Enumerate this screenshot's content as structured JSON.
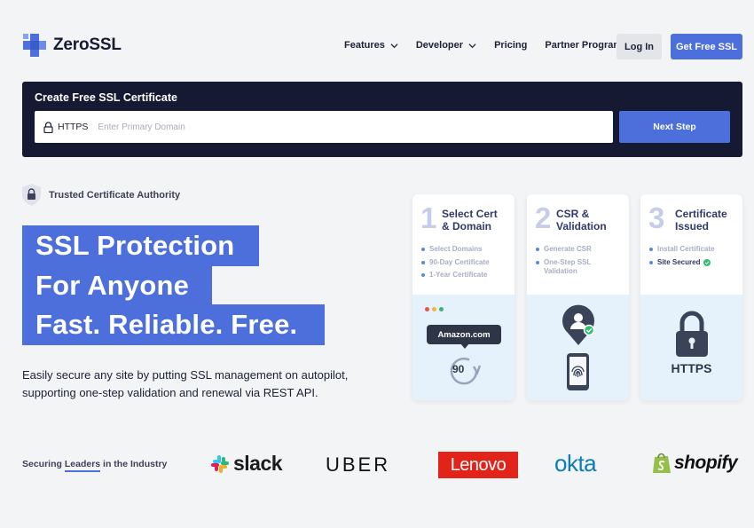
{
  "header": {
    "logo_text": "ZeroSSL",
    "nav": [
      {
        "label": "Features",
        "has_dropdown": true
      },
      {
        "label": "Developer",
        "has_dropdown": true
      },
      {
        "label": "Pricing",
        "has_dropdown": false
      },
      {
        "label": "Partner Program",
        "has_dropdown": false
      }
    ],
    "login_label": "Log In",
    "cta_label": "Get Free SSL"
  },
  "create": {
    "title": "Create Free SSL Certificate",
    "prefix": "HTTPS",
    "placeholder": "Enter Primary Domain",
    "value": "",
    "next_label": "Next Step"
  },
  "hero": {
    "trusted": "Trusted Certificate Authority",
    "line1": "SSL Protection",
    "line2": "For Anyone",
    "line3": "Fast. Reliable. Free.",
    "subtitle": "Easily secure any site by putting SSL management on autopilot, supporting one-step validation and renewal via REST API."
  },
  "steps": [
    {
      "num": "1",
      "title_line1": "Select Cert",
      "title_line2": "& Domain",
      "items": [
        "Select Domains",
        "90-Day Certificate",
        "1-Year Certificate"
      ],
      "pill": "Amazon.com",
      "badge": "90"
    },
    {
      "num": "2",
      "title_line1": "CSR &",
      "title_line2": "Validation",
      "items": [
        "Generate CSR",
        "One-Step SSL Validation"
      ]
    },
    {
      "num": "3",
      "title_line1": "Certificate",
      "title_line2": "Issued",
      "items": [
        "Install Certificate",
        "Site Secured"
      ],
      "big_label": "HTTPS"
    }
  ],
  "leaders": {
    "prefix": "Securing ",
    "highlight": "Leaders",
    "suffix": " in the Industry",
    "brands": [
      "slack",
      "UBER",
      "Lenovo",
      "okta",
      "shopify"
    ]
  },
  "colors": {
    "accent": "#4d6fdb",
    "dark": "#151a32",
    "background": "#f3f4f6",
    "card_bottom": "#e6f2fb",
    "lenovo_red": "#e2231a",
    "okta_blue": "#0a7bbd",
    "success_green": "#2fbf71"
  },
  "icons": [
    "zerossl-logo-icon",
    "chevron-down-icon",
    "lock-icon",
    "shield-lock-icon",
    "check-circle-icon",
    "refresh-icon",
    "user-location-pin-icon",
    "fingerprint-phone-icon",
    "padlock-icon",
    "slack-logo-icon",
    "shopify-bag-icon"
  ]
}
